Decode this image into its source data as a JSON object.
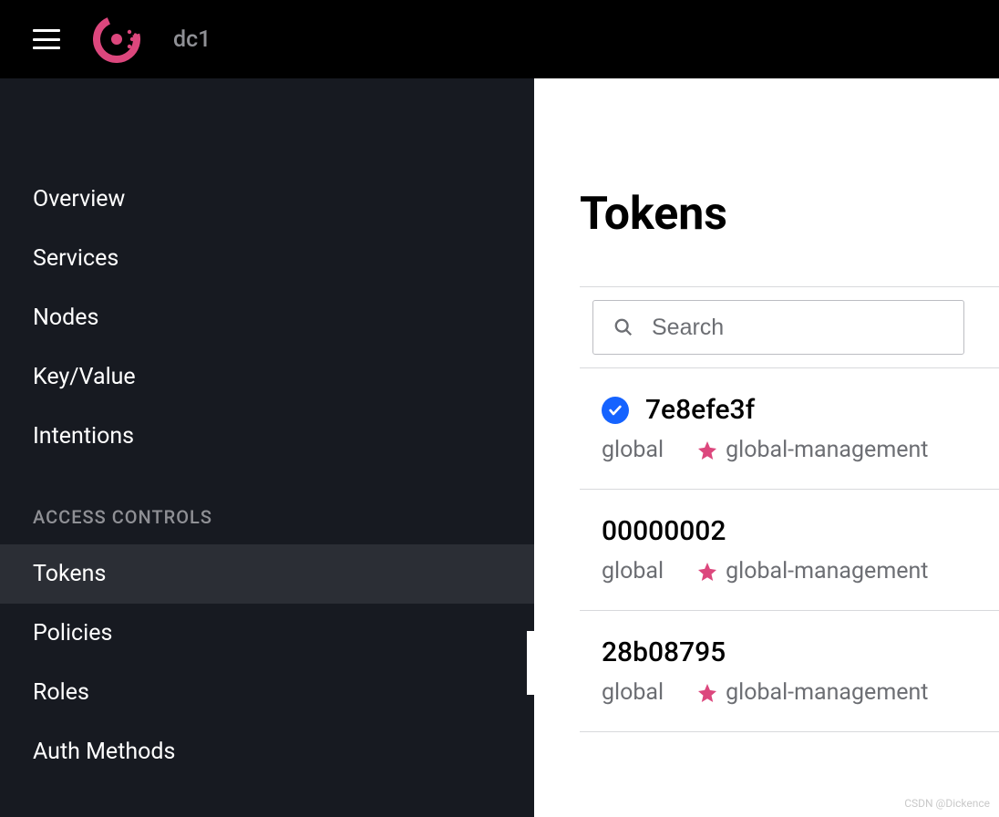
{
  "header": {
    "datacenter": "dc1"
  },
  "sidebar": {
    "main_items": [
      {
        "label": "Overview"
      },
      {
        "label": "Services"
      },
      {
        "label": "Nodes"
      },
      {
        "label": "Key/Value"
      },
      {
        "label": "Intentions"
      }
    ],
    "section_title": "ACCESS CONTROLS",
    "access_items": [
      {
        "label": "Tokens",
        "active": true
      },
      {
        "label": "Policies"
      },
      {
        "label": "Roles"
      },
      {
        "label": "Auth Methods"
      }
    ]
  },
  "main": {
    "title": "Tokens",
    "search_placeholder": "Search",
    "tokens": [
      {
        "id": "7e8efe3f",
        "scope": "global",
        "policy": "global-management",
        "checked": true
      },
      {
        "id": "00000002",
        "scope": "global",
        "policy": "global-management",
        "checked": false
      },
      {
        "id": "28b08795",
        "scope": "global",
        "policy": "global-management",
        "checked": false
      }
    ]
  },
  "watermark": "CSDN @Dickence"
}
